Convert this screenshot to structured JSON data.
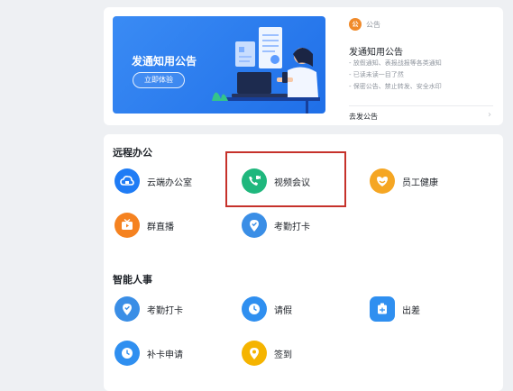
{
  "banner": {
    "title": "发通知用公告",
    "button_label": "立即体验"
  },
  "notice": {
    "tag": "公告",
    "tag_icon": "公",
    "title": "发通知用公告",
    "lines": [
      "- 放假通知、表报战报等各类通知",
      "- 已读未读一目了然",
      "- 保密公告、禁止转发、安全水印"
    ],
    "link_label": "去发公告"
  },
  "sections": [
    {
      "title": "远程办公",
      "items": [
        {
          "label": "云端办公室",
          "icon": "cloud-office-icon",
          "color": "#1f7cf5"
        },
        {
          "label": "视频会议",
          "icon": "video-call-icon",
          "color": "#1fb77d"
        },
        {
          "label": "员工健康",
          "icon": "employee-health-icon",
          "color": "#f5a623"
        },
        {
          "label": "群直播",
          "icon": "live-stream-icon",
          "color": "#f58220"
        },
        {
          "label": "考勤打卡",
          "icon": "attendance-icon",
          "color": "#3a8ee6"
        }
      ]
    },
    {
      "title": "智能人事",
      "items": [
        {
          "label": "考勤打卡",
          "icon": "attendance-icon",
          "color": "#3a8ee6"
        },
        {
          "label": "请假",
          "icon": "leave-icon",
          "color": "#2f8ff0"
        },
        {
          "label": "出差",
          "icon": "business-trip-icon",
          "color": "#2f8ff0"
        },
        {
          "label": "补卡申请",
          "icon": "clock-fix-icon",
          "color": "#2f8ff0"
        },
        {
          "label": "签到",
          "icon": "sign-in-icon",
          "color": "#f5b400"
        }
      ]
    }
  ]
}
